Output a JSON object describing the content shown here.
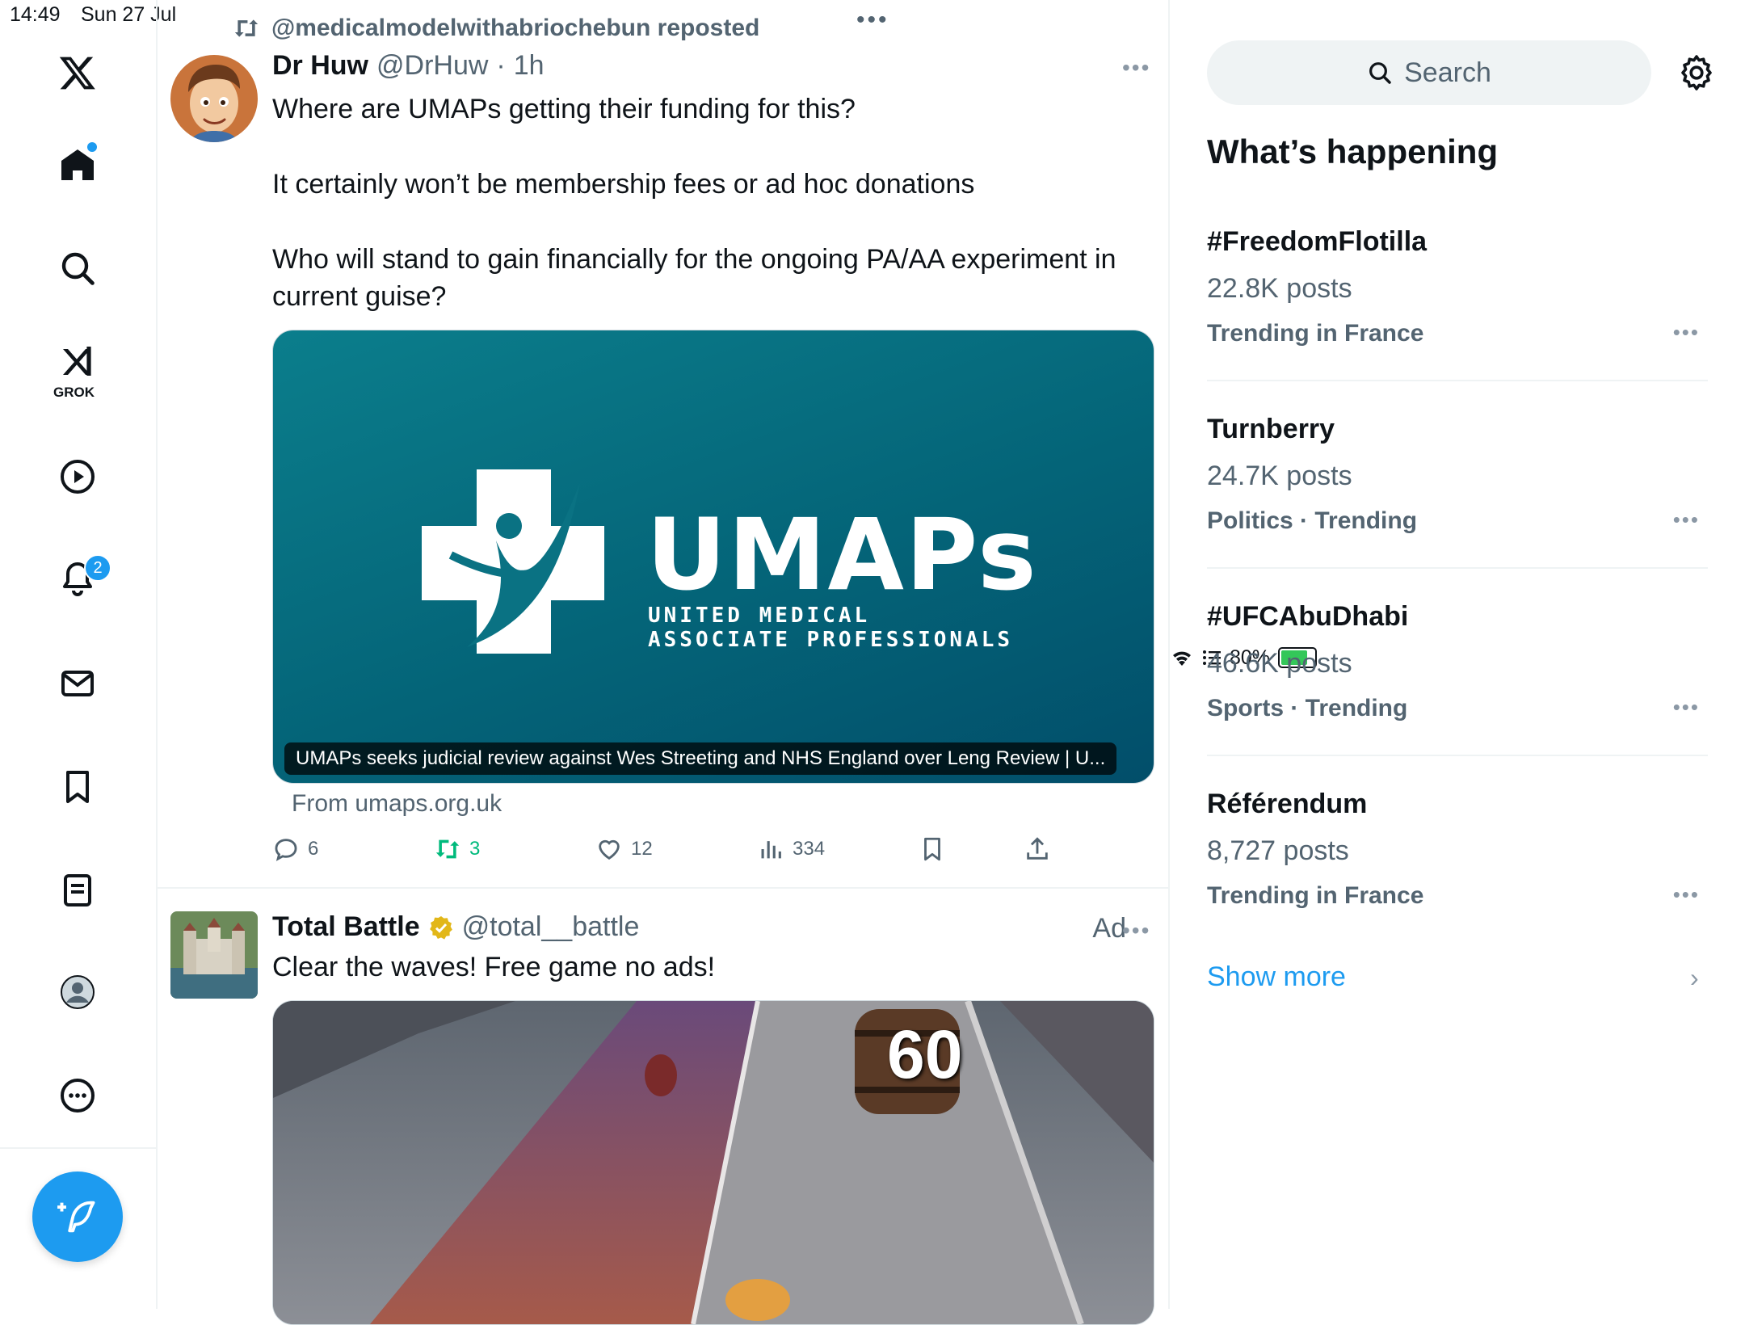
{
  "status_bar": {
    "time": "14:49",
    "date": "Sun 27 Jul",
    "battery": "80%"
  },
  "nav": {
    "items": [
      "x-logo",
      "home",
      "explore",
      "grok",
      "videos",
      "notifications",
      "messages",
      "bookmarks",
      "lists",
      "profile",
      "more"
    ],
    "grok_label": "GROK",
    "notifications_badge": "2"
  },
  "feed": {
    "repost_label": "@medicalmodelwithabriochebun reposted",
    "tweet1": {
      "name": "Dr Huw",
      "handle": "@DrHuw",
      "sep": "·",
      "time": "1h",
      "paragraphs": [
        "Where are UMAPs getting their funding for this?",
        "It certainly won’t be membership fees or ad hoc donations",
        "Who will stand to gain financially for the ongoing PA/AA experiment in current guise?"
      ],
      "card": {
        "logo_text": "UMAPs",
        "logo_sub1": "UNITED MEDICAL",
        "logo_sub2": "ASSOCIATE PROFESSIONALS",
        "caption": "UMAPs seeks judicial review against Wes Streeting and NHS England over Leng Review | U...",
        "source": "From umaps.org.uk"
      },
      "actions": {
        "replies": "6",
        "reposts": "3",
        "likes": "12",
        "views": "334"
      }
    },
    "tweet2": {
      "name": "Total Battle",
      "handle": "@total__battle",
      "ad_label": "Ad",
      "text": "Clear the waves! Free game no ads!",
      "barrel_number": "60"
    }
  },
  "sidebar": {
    "search_placeholder": "Search",
    "section_title": "What’s happening",
    "trends": [
      {
        "name": "#FreedomFlotilla",
        "posts": "22.8K posts",
        "context": "Trending in France"
      },
      {
        "name": "Turnberry",
        "posts": "24.7K posts",
        "context": "Politics · Trending"
      },
      {
        "name": "#UFCAbuDhabi",
        "posts": "46.6K posts",
        "context": "Sports · Trending"
      },
      {
        "name": "Référendum",
        "posts": "8,727 posts",
        "context": "Trending in France"
      }
    ],
    "show_more": "Show more"
  },
  "colors": {
    "accent": "#1d9bf0",
    "repost_green": "#00ba7c",
    "umaps_teal": "#046478",
    "verified_gold": "#e2b719"
  }
}
